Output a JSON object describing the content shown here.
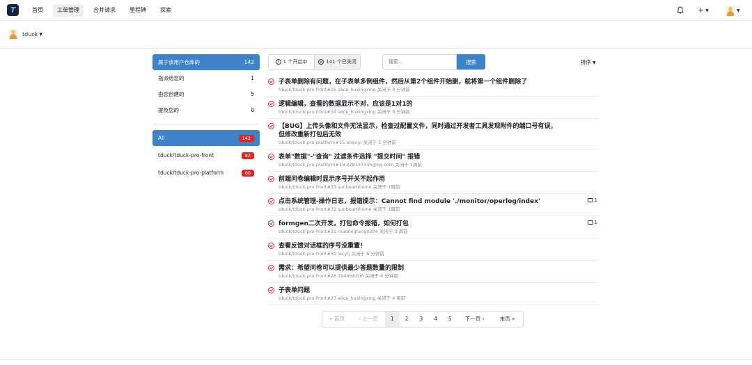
{
  "nav": {
    "logo_letter": "T",
    "items": [
      "首页",
      "工单管理",
      "合并请求",
      "里程碑",
      "探索"
    ],
    "active_index": 1,
    "plus": "+"
  },
  "context": {
    "username": "tduck"
  },
  "sidebar": {
    "filters": [
      {
        "label": "属于该用户仓库的",
        "count": "142"
      },
      {
        "label": "指派给您的",
        "count": "1"
      },
      {
        "label": "由您创建的",
        "count": "5"
      },
      {
        "label": "提及您的",
        "count": "0"
      }
    ],
    "repos": [
      {
        "label": "All",
        "count": "142"
      },
      {
        "label": "tduck/tduck-pro-front",
        "count": "82"
      },
      {
        "label": "tduck/tduck-pro-platform",
        "count": "60"
      }
    ]
  },
  "state_tabs": {
    "open": "1 个开启中",
    "closed": "141 个已关闭"
  },
  "search": {
    "placeholder": "搜索...",
    "button": "搜索"
  },
  "sort_label": "排序",
  "issues": [
    {
      "title": "子表单删除有问题，在子表单多例组件，然后从第2个组件开始删，就将第一个组件删除了",
      "meta": "tduck/tduck-pro-front#35  alice_huxingxing 关闭于 8 分钟前",
      "comments": ""
    },
    {
      "title": "逻辑编辑，查看的数据显示不对，应该是1对1的",
      "meta": "tduck/tduck-pro-front#34  alice_huxingxing 关闭于 8 分钟前",
      "comments": ""
    },
    {
      "title": "【BUG】上传头像和文件无法显示，检查过配置文件，同时通过开发者工具发现附件的端口号有误，但修改重新打包后无效",
      "meta": "tduck/tduck-pro-platform#15  etqiuyi 关闭于 5 分钟前",
      "comments": ""
    },
    {
      "title": "表单\"数据\"-\"查询\" 过滤条件选择 \"提交时间\" 报错",
      "meta": "tduck/tduck-pro-platform#13  328137335@qq.com 关闭于 1周前",
      "comments": ""
    },
    {
      "title": "前端问卷编辑时显示序号开关不起作用",
      "meta": "tduck/tduck-pro-front#33  sunbeamhome 关闭于 1周前",
      "comments": ""
    },
    {
      "title": "点击系统管理-操作日志，报错提示：Cannot find module './monitor/operlog/index'",
      "meta": "tduck/tduck-pro-front#32  sunbeamhome 关闭于 1周前",
      "comments": "1"
    },
    {
      "title": "formgen二次开发，打包命令报错，如何打包",
      "meta": "tduck/tduck-pro-front#31  madongfang0204 关闭于 3 周前",
      "comments": "1"
    },
    {
      "title": "查看反馈对话框的序号没重置！",
      "meta": "tduck/tduck-pro-front#30  lecyfj 关闭于 8 分钟前",
      "comments": ""
    },
    {
      "title": "需求：希望问卷可以提供最少答题数量的限制",
      "meta": "tduck/tduck-pro-front#28  294466206 关闭于 8 分钟前",
      "comments": ""
    },
    {
      "title": "子表单问题",
      "meta": "tduck/tduck-pro-front#27  alice_huxingxing 关闭于 4 周前",
      "comments": ""
    }
  ],
  "pager": {
    "first": "« 首页",
    "prev": "‹ 上一页",
    "pages": [
      "1",
      "2",
      "3",
      "4",
      "5"
    ],
    "next": "下一页 ›",
    "last": "末页 »"
  }
}
